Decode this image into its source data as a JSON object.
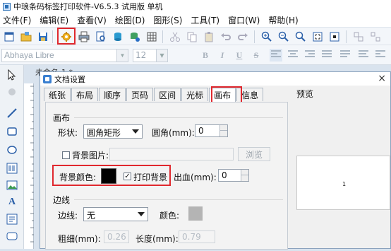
{
  "window": {
    "title": "中琅条码标签打印软件-V6.5.3 试用版 单机"
  },
  "menu": [
    {
      "label": "文件(F)"
    },
    {
      "label": "编辑(E)"
    },
    {
      "label": "查看(V)"
    },
    {
      "label": "绘图(D)"
    },
    {
      "label": "图形(S)"
    },
    {
      "label": "工具(T)"
    },
    {
      "label": "窗口(W)"
    },
    {
      "label": "帮助(H)"
    }
  ],
  "format": {
    "font_name": "Abhaya Libre",
    "font_size": "12",
    "bold": "B",
    "italic": "I",
    "underline": "U",
    "strike": "S"
  },
  "document": {
    "tab_label": "未命名-1 *"
  },
  "dialog": {
    "title": "文档设置",
    "close": "×",
    "tabs": [
      {
        "label": "纸张"
      },
      {
        "label": "布局"
      },
      {
        "label": "顺序"
      },
      {
        "label": "页码"
      },
      {
        "label": "区间"
      },
      {
        "label": "光标"
      },
      {
        "label": "画布"
      },
      {
        "label": "信息"
      }
    ],
    "active_tab": "画布",
    "preview": {
      "label": "预览",
      "number": "1"
    },
    "canvas": {
      "group_title": "画布",
      "shape_label": "形状:",
      "shape_value": "圆角矩形",
      "corner_label": "圆角(mm):",
      "corner_value": "0",
      "bg_image_label": "背景图片:",
      "browse_label": "浏览",
      "bg_color_label": "背景颜色:",
      "bg_color": "#000000",
      "print_bg_label": "打印背景",
      "print_bg_checked": "✓",
      "bleed_label": "出血(mm):",
      "bleed_value": "0"
    },
    "border": {
      "group_title": "边线",
      "line_label": "边线:",
      "line_value": "无",
      "color_label": "颜色:",
      "color": "#b4b4b4",
      "width_label": "粗细(mm):",
      "width_value": "0.26",
      "length_label": "长度(mm):",
      "length_value": "0.79"
    }
  },
  "colors": {
    "highlight": "#e0282e",
    "accent": "#2a6fb5"
  }
}
